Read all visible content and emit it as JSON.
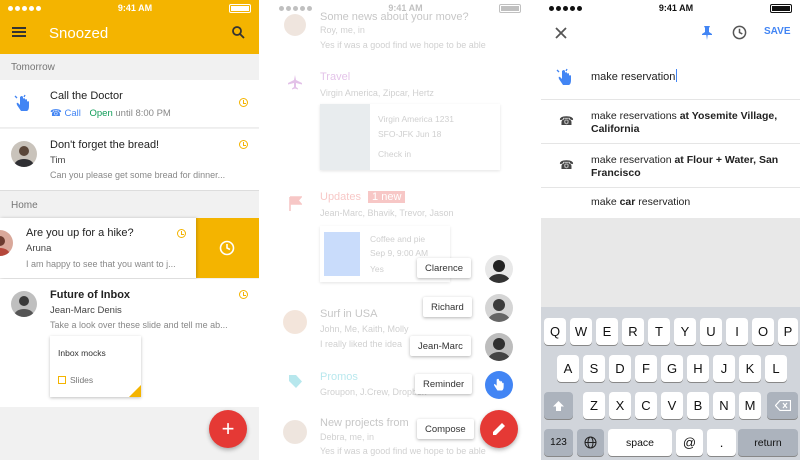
{
  "status": {
    "time": "9:41 AM"
  },
  "snoozed": {
    "title": "Snoozed",
    "sections": {
      "tomorrow": "Tomorrow",
      "home": "Home"
    },
    "doctor": {
      "title": "Call the Doctor",
      "call": "Call",
      "open": "Open",
      "until": "until 8:00 PM"
    },
    "bread": {
      "title": "Don't forget the bread!",
      "sender": "Tim",
      "snippet": "Can you please get some bread for dinner..."
    },
    "hike": {
      "title": "Are you up for a hike?",
      "sender": "Aruna",
      "snippet": "I am happy to see that you want to j..."
    },
    "inbox": {
      "title": "Future of Inbox",
      "sender": "Jean-Marc Denis",
      "snippet": "Take a look over these slide and tell me ab...",
      "attachment_title": "Inbox mocks",
      "attachment_type": "Slides"
    },
    "fab_label": "+"
  },
  "compose_menu": {
    "background_items": [
      {
        "title": "Some news about your move?",
        "sub": "Roy, me, in",
        "body": "Yes if was a good find we hope to be able"
      },
      {
        "title": "Travel",
        "sub": "Virgin America, Zipcar, Hertz"
      },
      {
        "title": "SFO-JFK Jun 18",
        "sub": "Check in",
        "body": "Virgin America 1231"
      },
      {
        "title": "Updates",
        "badge": "1 new",
        "sub": "Jean-Marc, Bhavik, Trevor, Jason"
      },
      {
        "title": "Coffee and pie",
        "sub": "Sep 9, 9:00 AM",
        "body": "Yes"
      },
      {
        "title": "Surf in USA",
        "sub": "John, Me, Kaith, Molly",
        "body": "I really liked the idea"
      },
      {
        "title": "Promos",
        "sub": "Groupon, J.Crew, Dropbox"
      },
      {
        "title": "New projects from",
        "sub": "Debra, me, in",
        "body": "Yes if was a good find we hope to be able"
      }
    ],
    "actions": [
      {
        "label": "Clarence"
      },
      {
        "label": "Richard"
      },
      {
        "label": "Jean-Marc"
      },
      {
        "label": "Reminder"
      },
      {
        "label": "Compose"
      }
    ]
  },
  "reminder": {
    "save_label": "SAVE",
    "input_value": "make reservation",
    "suggestions": [
      {
        "prefix": "make reservations ",
        "bold": "at Yosemite Village, California"
      },
      {
        "prefix": "make reservation ",
        "bold": "at Flour + Water, San Francisco"
      },
      {
        "prefix": "make ",
        "bold": "car",
        "suffix": " reservation"
      }
    ]
  },
  "keyboard": {
    "row1": [
      "Q",
      "W",
      "E",
      "R",
      "T",
      "Y",
      "U",
      "I",
      "O",
      "P"
    ],
    "row2": [
      "A",
      "S",
      "D",
      "F",
      "G",
      "H",
      "J",
      "K",
      "L"
    ],
    "row3": [
      "Z",
      "X",
      "C",
      "V",
      "B",
      "N",
      "M"
    ],
    "k123": "123",
    "space": "space",
    "at": "@",
    "dot": ".",
    "return": "return"
  },
  "colors": {
    "snoozed_yellow": "#f4b400",
    "fab_red": "#e53935",
    "blue": "#4285f4",
    "open_green": "#0f9d58"
  }
}
